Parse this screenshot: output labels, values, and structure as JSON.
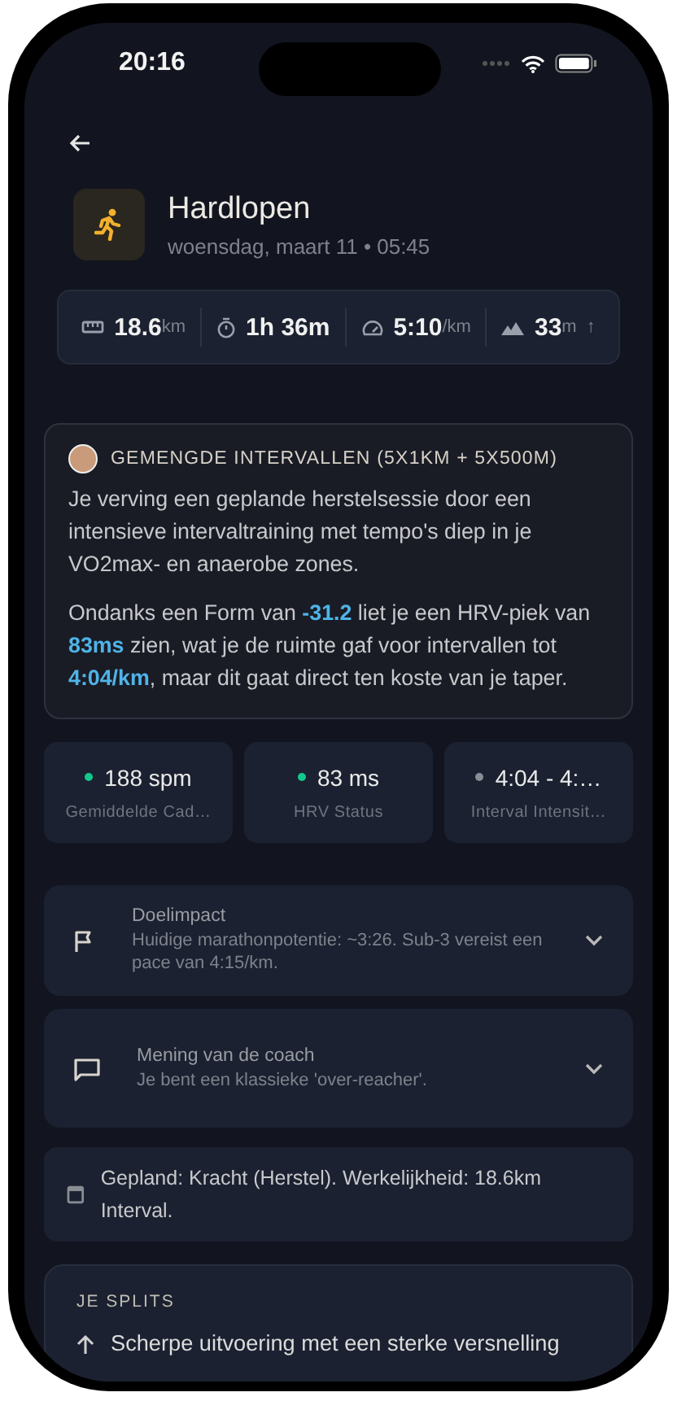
{
  "status_bar": {
    "time": "20:16"
  },
  "header": {
    "title": "Hardlopen",
    "subtitle": "woensdag, maart 11 • 05:45"
  },
  "stats": [
    {
      "value": "18.6",
      "unit": "km"
    },
    {
      "value": "1h 36m"
    },
    {
      "value": "5:10",
      "unit": "/km"
    },
    {
      "value": "33",
      "unit": "m",
      "suffix": "↑"
    }
  ],
  "insight": {
    "title": "GEMENGDE INTERVALLEN (5X1KM + 5X500M)",
    "paragraphs": [
      "Je verving een geplande herstelsessie door een intensieve intervaltraining met tempo's diep in je VO2max- en anaerobe zones.",
      "Ondanks een Form van **-31.2** liet je een HRV-piek van **83ms** zien, wat je de ruimte gaf voor intervallen tot **4:04/km**, maar dit gaat direct ten koste van je taper."
    ]
  },
  "metrics": [
    {
      "value": "188 spm",
      "label": "Gemiddelde Cad…",
      "color": "#10c98a"
    },
    {
      "value": "83 ms",
      "label": "HRV Status",
      "color": "#10c98a"
    },
    {
      "value": "4:04 - 4:…",
      "label": "Interval Intensit…",
      "color": "#8a8d94"
    }
  ],
  "accordions": [
    {
      "title": "Doelimpact",
      "text": "Huidige marathonpotentie: ~3:26. Sub-3 vereist een pace van 4:15/km.",
      "expanded": false
    },
    {
      "title": "Mening van de coach",
      "text": "Je bent een klassieke 'over-reacher'.",
      "expanded": false
    }
  ],
  "plan_note": "Gepland: Kracht (Herstel). Werkelijkheid: 18.6km Interval.",
  "splits": {
    "title": "JE SPLITS",
    "items": [
      "Scherpe uitvoering met een sterke versnelling"
    ]
  }
}
